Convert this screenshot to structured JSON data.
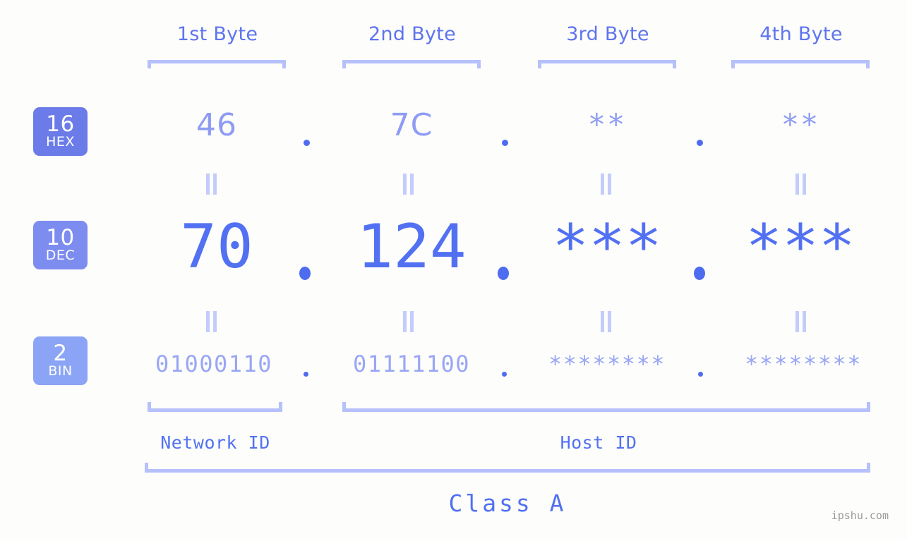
{
  "background_color": "#fdfdfb",
  "accent_strong": "#5271f2",
  "accent_mid": "#8e9cf3",
  "accent_light": "#b6c0fb",
  "byte_headers": [
    {
      "label": "1st Byte"
    },
    {
      "label": "2nd Byte"
    },
    {
      "label": "3rd Byte"
    },
    {
      "label": "4th Byte"
    }
  ],
  "radix_rows": [
    {
      "badge_number": "16",
      "badge_abbr": "HEX",
      "badge_color": "#6b7ce8",
      "values": [
        "46",
        "7C",
        "**",
        "**"
      ],
      "separator": "."
    },
    {
      "badge_number": "10",
      "badge_abbr": "DEC",
      "badge_color": "#7d8cef",
      "values": [
        "70",
        "124",
        "***",
        "***"
      ],
      "separator": "."
    },
    {
      "badge_number": "2",
      "badge_abbr": "BIN",
      "badge_color": "#8ba4f5",
      "values": [
        "01000110",
        "01111100",
        "********",
        "********"
      ],
      "separator": "."
    }
  ],
  "equals_marks": {
    "glyph": "=",
    "count_per_row": 4,
    "rows": 2
  },
  "segments": {
    "network_id_label": "Network ID",
    "host_id_label": "Host ID"
  },
  "class_label": "Class A",
  "watermark": "ipshu.com"
}
